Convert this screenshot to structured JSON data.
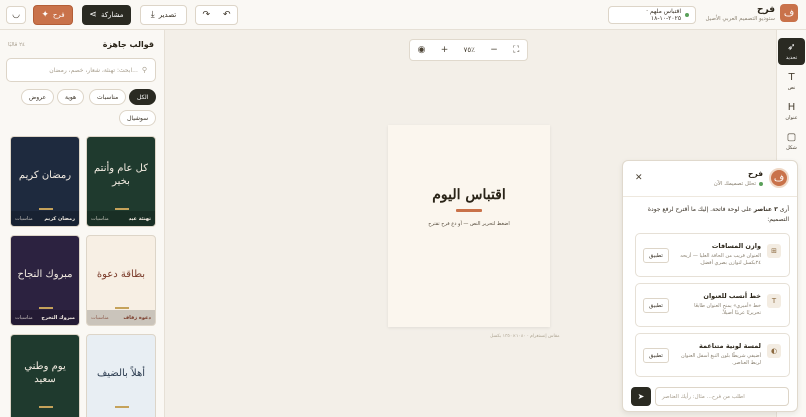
{
  "brand": {
    "logo_letter": "ف",
    "name": "فرح",
    "subtitle": "ستوديو التصميم العربي الأصيل"
  },
  "document": {
    "title": "اقتباس ملهم · ٢٠٢٥-١٠-١٨"
  },
  "toolbar": {
    "brand_button": "فرح",
    "share_label": "مشاركة",
    "export_label": "تصدير"
  },
  "left_panel": {
    "title": "قوالب جاهزة",
    "count": "٢٤ قالبًا",
    "search_placeholder": "ابحث: تهنئة، شعار، خصم، رمضان...",
    "filters": [
      "الكل",
      "مناسبات",
      "هوية",
      "عروض",
      "سوشيال"
    ],
    "templates": [
      {
        "art": "كل عام وأنتم بخير",
        "name": "تهنئة عيد",
        "tag": "مناسبات",
        "bg": "#1f3a2e",
        "fg": "#f3ece2"
      },
      {
        "art": "رمضان كريم",
        "name": "رمضان كريم",
        "tag": "مناسبات",
        "bg": "#1e2a3e",
        "fg": "#f3ece2"
      },
      {
        "art": "بطاقة دعوة",
        "name": "دعوة زفاف",
        "tag": "مناسبات",
        "bg": "#f7efe4",
        "fg": "#7a3b2a"
      },
      {
        "art": "مبروك النجاح",
        "name": "مبروك التخرج",
        "tag": "مناسبات",
        "bg": "#2c2240",
        "fg": "#f3ece2"
      },
      {
        "art": "أهلاً بالضيف",
        "name": "",
        "tag": "",
        "bg": "#e8eef3",
        "fg": "#2a3a4e"
      },
      {
        "art": "يوم وطني سعيد",
        "name": "",
        "tag": "",
        "bg": "#1f3a2e",
        "fg": "#f3ece2"
      }
    ]
  },
  "canvas": {
    "zoom": "٧٥٪",
    "art_title": "اقتباس اليوم",
    "art_subtitle": "اضغط لتحرير النص — أو دع فرح تقترح",
    "caption": "مقاس إنستغرام · ١٠٨٠×١٣٥٠ بكسل"
  },
  "tools": [
    {
      "label": "تحديد",
      "icon": "cursor"
    },
    {
      "label": "نص",
      "icon": "text"
    },
    {
      "label": "عنوان",
      "icon": "heading"
    },
    {
      "label": "شكل",
      "icon": "shape"
    }
  ],
  "assistant": {
    "name": "فرح",
    "status": "تحلل تصميمك الآن",
    "message_intro": "أرى",
    "message_bold": "٣ عناصر",
    "message_rest": "على لوحة فاتحة. إليك ما أقترح لرفع جودة التصميم:",
    "suggestions": [
      {
        "title": "وازن المسافات",
        "desc": "العنوان قريب من الحافة العليا — أزيحه ٢٤بكسل لتوازن بصري أفضل.",
        "action": "تطبيق",
        "icon": "layout-icon"
      },
      {
        "title": "خط أنسب للعنوان",
        "desc": "خط «أميري» يمنح العنوان طابعًا تحريريًا عربيًا أصيلاً.",
        "action": "تطبيق",
        "icon": "font-icon"
      },
      {
        "title": "لمسة لونية متناغمة",
        "desc": "أضيفي شريطًا بلون التبغ أسفل العنوان لربط العناصر.",
        "action": "تطبيق",
        "icon": "palette-icon"
      }
    ],
    "input_placeholder": "اطلب من فرح... مثال: رأيك العناصر"
  },
  "colors": {
    "accent": "#c9724a",
    "dark": "#2a2a22",
    "gold": "#c5a25a"
  }
}
